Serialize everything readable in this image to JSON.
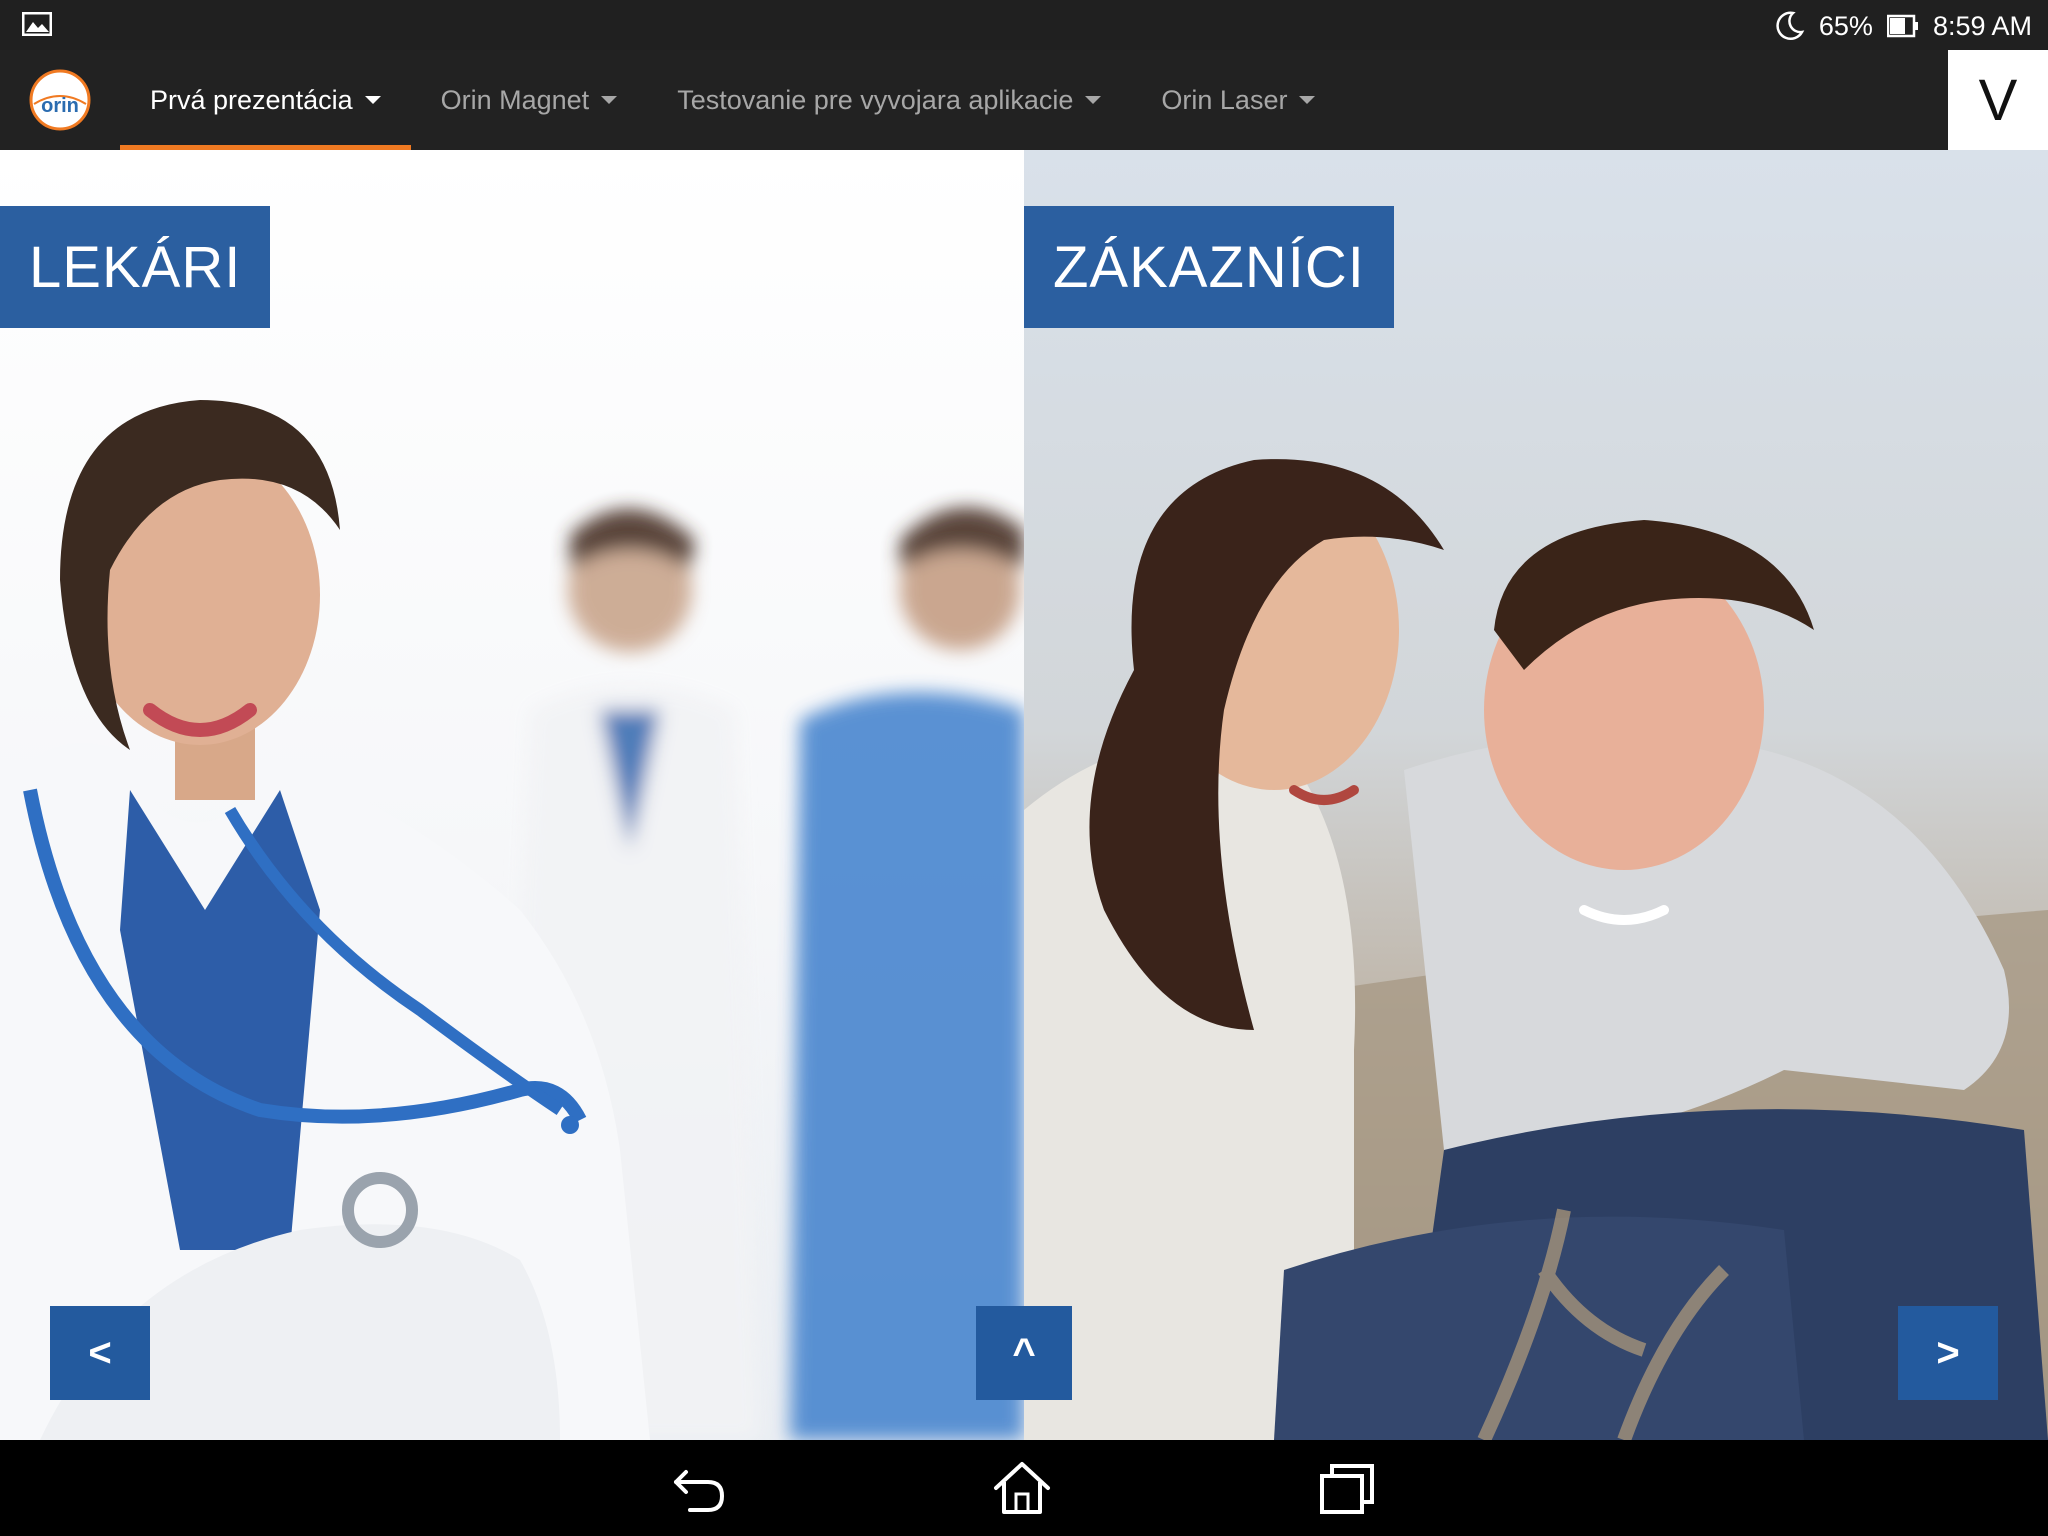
{
  "status_bar": {
    "battery_percent": "65%",
    "time": "8:59 AM",
    "icons": [
      "gallery-icon",
      "moon-icon",
      "battery-icon"
    ]
  },
  "app_bar": {
    "logo_text": "orin",
    "nav": [
      {
        "label": "Prvá prezentácia",
        "active": true
      },
      {
        "label": "Orin Magnet",
        "active": false
      },
      {
        "label": "Testovanie pre vyvojara aplikacie",
        "active": false
      },
      {
        "label": "Orin Laser",
        "active": false
      }
    ],
    "right_button_label": "V",
    "accent_color": "#f07a22"
  },
  "panels": {
    "left_label": "LEKÁRI",
    "right_label": "ZÁKAZNÍCI",
    "label_color": "#2b5fa0"
  },
  "controls": {
    "prev_label": "<",
    "up_label": "^",
    "next_label": ">"
  },
  "system_nav": {
    "icons": [
      "back-icon",
      "home-icon",
      "recent-apps-icon"
    ]
  }
}
